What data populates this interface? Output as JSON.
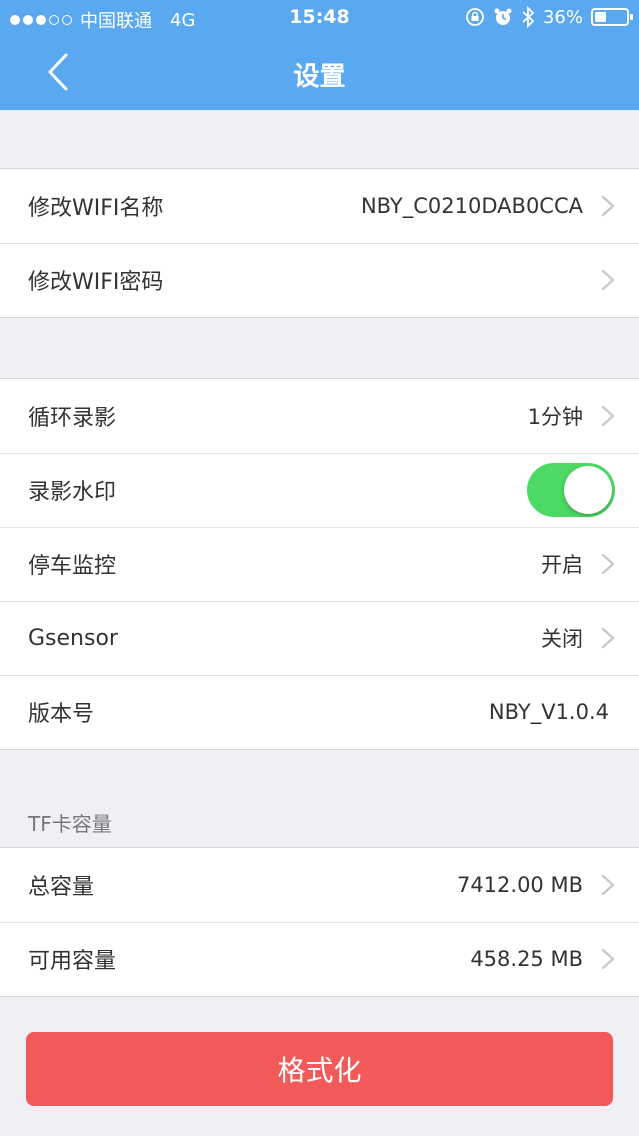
{
  "status_bar": {
    "carrier": "中国联通",
    "network": "4G",
    "time": "15:48",
    "battery": "36%",
    "battery_level": 0.36
  },
  "nav": {
    "title": "设置"
  },
  "wifi_group": [
    {
      "label": "修改WIFI名称",
      "value": "NBY_C0210DAB0CCA"
    },
    {
      "label": "修改WIFI密码",
      "value": ""
    }
  ],
  "record_group": {
    "loop_record": {
      "label": "循环录影",
      "value": "1分钟"
    },
    "watermark": {
      "label": "录影水印",
      "enabled": true
    },
    "parking_monitor": {
      "label": "停车监控",
      "value": "开启"
    },
    "gsensor": {
      "label": "Gsensor",
      "value": "关闭"
    },
    "version": {
      "label": "版本号",
      "value": "NBY_V1.0.4"
    }
  },
  "tf_card": {
    "section_title": "TF卡容量",
    "total": {
      "label": "总容量",
      "value": "7412.00 MB"
    },
    "available": {
      "label": "可用容量",
      "value": "458.25 MB"
    }
  },
  "format_button": {
    "label": "格式化"
  },
  "colors": {
    "nav_blue": "#5aa8f0",
    "toggle_green": "#4cd964",
    "format_red": "#f25a5a"
  }
}
